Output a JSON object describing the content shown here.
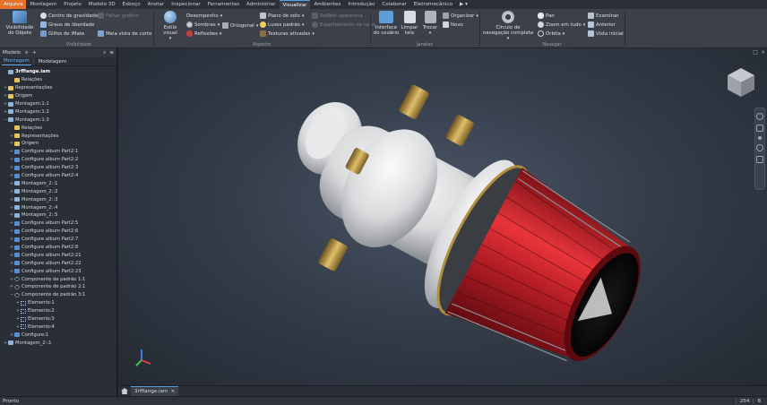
{
  "menu": {
    "tabs": [
      "Arquivo",
      "Montagem",
      "Projeto",
      "Modelo 3D",
      "Esboço",
      "Anotar",
      "Inspecionar",
      "Ferramentas",
      "Administrar",
      "Visualizar",
      "Ambientes",
      "Introdução",
      "Colaborar",
      "Eletromecânico"
    ],
    "active": "Visualizar"
  },
  "ribbon": {
    "visibilidade": {
      "title": "Visibilidade",
      "big": "Visibilidade do Objeto",
      "items": [
        "Centro de gravidade",
        "Graus de liberdade",
        "Glifos de iMate",
        "Falhar gráfico",
        "Meia vista de corte"
      ]
    },
    "aspecto": {
      "title": "Aspecto",
      "big": "Estilo visual",
      "col1": [
        "Desempenho",
        "Sombras",
        "Reflexões"
      ],
      "ortho": "Ortogonal",
      "col2": [
        "Plano de solo",
        "Luzes padrão",
        "Texturas ativadas"
      ],
      "col3": [
        "Refletir aparência",
        "Espelhamento de raios"
      ]
    },
    "janelas": {
      "title": "Janelas",
      "big": [
        "Interface do usuário",
        "Limpar tela",
        "Trocar"
      ],
      "side": [
        "Organizar",
        "Novo"
      ]
    },
    "navegar": {
      "title": "Navegar",
      "big": "Círculo de navegação completa",
      "col1": [
        "Pan",
        "Zoom em tudo",
        "Órbita"
      ],
      "col2": [
        "Examinar",
        "Anterior",
        "Vista inicial"
      ]
    }
  },
  "browser": {
    "title": "Modelo",
    "tabs": [
      "Montagem",
      "Modelagem"
    ],
    "tree": [
      {
        "label": "3rfflange.iam",
        "depth": 0,
        "icon": "asm",
        "bold": true,
        "toggle": ""
      },
      {
        "label": "Relações",
        "depth": 1,
        "icon": "folder",
        "toggle": ""
      },
      {
        "label": "Representações",
        "depth": 0,
        "icon": "folder",
        "toggle": "+"
      },
      {
        "label": "Origem",
        "depth": 0,
        "icon": "folder",
        "toggle": "+"
      },
      {
        "label": "Montagem:1:1",
        "depth": 0,
        "icon": "asm",
        "toggle": "+"
      },
      {
        "label": "Montagem:1:2",
        "depth": 0,
        "icon": "asm",
        "toggle": "+"
      },
      {
        "label": "Montagem:1:3",
        "depth": 0,
        "icon": "asm",
        "toggle": "−"
      },
      {
        "label": "Relações",
        "depth": 1,
        "icon": "folder",
        "toggle": ""
      },
      {
        "label": "Representações",
        "depth": 1,
        "icon": "folder",
        "toggle": "+"
      },
      {
        "label": "Origem",
        "depth": 1,
        "icon": "folder",
        "toggle": "+"
      },
      {
        "label": "Configure album Part2:1",
        "depth": 1,
        "icon": "part",
        "toggle": "+"
      },
      {
        "label": "Configure album Part2:2",
        "depth": 1,
        "icon": "part",
        "toggle": "+"
      },
      {
        "label": "Configure album Part2:3",
        "depth": 1,
        "icon": "part",
        "toggle": "+"
      },
      {
        "label": "Configure album Part2:4",
        "depth": 1,
        "icon": "part",
        "toggle": "+"
      },
      {
        "label": "Montagem_2::1",
        "depth": 1,
        "icon": "asm",
        "toggle": "+"
      },
      {
        "label": "Montagem_2::2",
        "depth": 1,
        "icon": "asm",
        "toggle": "+"
      },
      {
        "label": "Montagem_2::3",
        "depth": 1,
        "icon": "asm",
        "toggle": "+"
      },
      {
        "label": "Montagem_2::4",
        "depth": 1,
        "icon": "asm",
        "toggle": "+"
      },
      {
        "label": "Montagem_2::5",
        "depth": 1,
        "icon": "asm",
        "toggle": "+"
      },
      {
        "label": "Configure album Part2:5",
        "depth": 1,
        "icon": "part",
        "toggle": "+"
      },
      {
        "label": "Configure album Part2:6",
        "depth": 1,
        "icon": "part",
        "toggle": "+"
      },
      {
        "label": "Configure album Part2:7",
        "depth": 1,
        "icon": "part",
        "toggle": "+"
      },
      {
        "label": "Configure album Part2:8",
        "depth": 1,
        "icon": "part",
        "toggle": "+"
      },
      {
        "label": "Configure album Part2:21",
        "depth": 1,
        "icon": "part",
        "toggle": "+"
      },
      {
        "label": "Configure album Part2:22",
        "depth": 1,
        "icon": "part",
        "toggle": "+"
      },
      {
        "label": "Configure album Part2:23",
        "depth": 1,
        "icon": "part",
        "toggle": "+"
      },
      {
        "label": "Componente de padrão 1:1",
        "depth": 1,
        "icon": "pattern",
        "toggle": "+"
      },
      {
        "label": "Componente de padrão 2:1",
        "depth": 1,
        "icon": "pattern",
        "toggle": "+"
      },
      {
        "label": "Componente de padrão 3:1",
        "depth": 1,
        "icon": "pattern",
        "toggle": "−"
      },
      {
        "label": "Elemento:1",
        "depth": 2,
        "icon": "elem",
        "toggle": "+"
      },
      {
        "label": "Elemento:2",
        "depth": 2,
        "icon": "elem",
        "toggle": "+"
      },
      {
        "label": "Elemento:3",
        "depth": 2,
        "icon": "elem",
        "toggle": "+"
      },
      {
        "label": "Elemento:4",
        "depth": 2,
        "icon": "elem",
        "toggle": "+"
      },
      {
        "label": "Configure:1",
        "depth": 1,
        "icon": "part",
        "toggle": "+"
      },
      {
        "label": "Montagem_2::1",
        "depth": 0,
        "icon": "asm",
        "toggle": "+"
      }
    ]
  },
  "document": {
    "tab": "3rfflange.iam"
  },
  "status": {
    "text": "Pronto",
    "count1": "254",
    "count2": "8"
  },
  "colors": {
    "accent": "#e8702a",
    "highlight": "#5aa0e0",
    "red_blades": "#c0202a",
    "brass": "#c9a246"
  }
}
